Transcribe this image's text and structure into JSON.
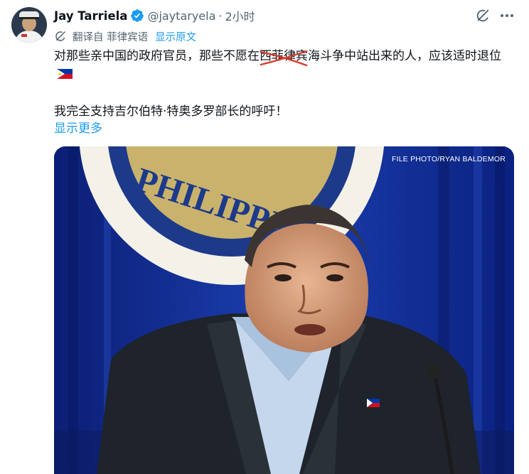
{
  "author": {
    "name": "Jay Tarriela",
    "handle": "@jaytaryela",
    "separator": "·",
    "time": "2小时"
  },
  "translation": {
    "label": "翻译自 菲律宾语",
    "show_original": "显示原文"
  },
  "tweet": {
    "line1_prefix": "对那些亲中国的政府官员，那些不愿在",
    "struck": "西菲律宾",
    "line1_suffix": "海斗争中站出来的人，应该适时退位",
    "line2": "我完全支持吉尔伯特·特奥多罗部长的呼吁！",
    "show_more": "显示更多"
  },
  "media": {
    "credit": "FILE PHOTO/RYAN BALDEMOR",
    "seal_text": "PHILIPPINES"
  },
  "icons": {
    "verified": "verified-badge-icon",
    "grok": "grok-icon",
    "more": "more-icon",
    "translate": "translate-icon",
    "flag": "philippines-flag-icon"
  },
  "colors": {
    "link": "#1d9bf0",
    "secondary_text": "#536471",
    "strike": "#d93a2b"
  }
}
